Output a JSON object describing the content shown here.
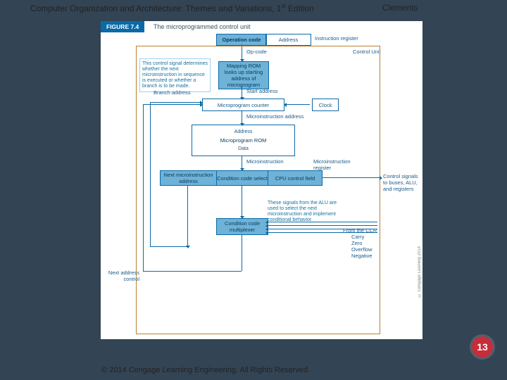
{
  "header": {
    "book": "Computer Organization and Architecture: Themes and Variations, 1",
    "sup": "st",
    "ed": " Edition",
    "author": "Clements"
  },
  "figure": {
    "label": "FIGURE 7.4",
    "caption": "The microprogrammed control unit"
  },
  "top": {
    "opcode": "Operation code",
    "addr": "Address",
    "ir": "Instruction register",
    "oclbl": "Op-code",
    "culbl": "Control Unit"
  },
  "b": {
    "maprom": "Mapping ROM looks up starting address of microprogram",
    "mpc": "Microprogram counter",
    "mprom_top": "Address",
    "mprom": "Microprogram ROM",
    "mprom_bot": "Data",
    "mir_next": "Next microinstruction address",
    "mir_cc": "Condition code select",
    "mir_cpu": "CPU control field",
    "ccmux": "Condition code multiplexer",
    "clock": "Clock"
  },
  "l": {
    "branchaddr": "Branch address",
    "startaddr": "Start address",
    "miaddr": "Microinstruction address",
    "mi": "Microinstruction",
    "mireg": "Microinstruction register",
    "ctrlout": "Control signals to buses, ALU, and registers",
    "nextaddr": "Next address control",
    "fromccr": "From the CCR",
    "carry": "Carry",
    "zero": "Zero",
    "ovf": "Overflow",
    "neg": "Negative"
  },
  "ann": {
    "a1": "This control signal determines whether the next microinstruction in sequence is executed or whether a branch is to be made.",
    "a2": "These signals from the ALU are used to select the next microinstruction and implement conditional behavior."
  },
  "credit": "© Cengage Learning 2014",
  "page": "13",
  "footer": "© 2014 Cengage Learning Engineering. All Rights Reserved."
}
